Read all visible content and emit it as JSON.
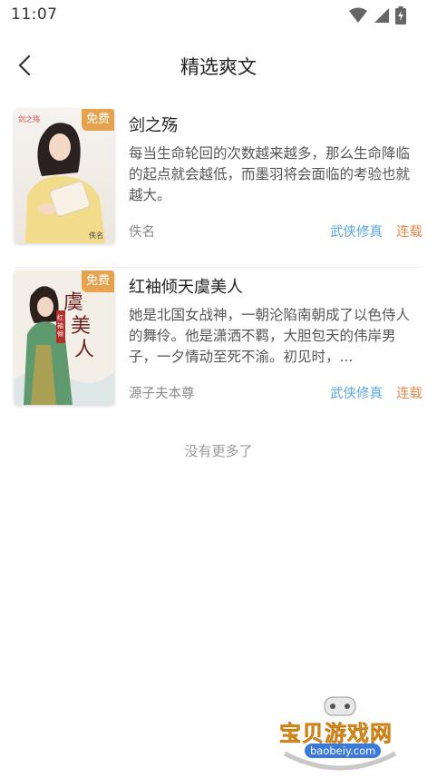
{
  "status_bar": {
    "time": "11:07",
    "icons": [
      "wifi-icon",
      "signal-icon",
      "battery-charging-icon"
    ]
  },
  "nav": {
    "back_icon": "chevron-left-icon",
    "title": "精选爽文"
  },
  "books": [
    {
      "free_tag": "免费",
      "title": "剑之殇",
      "description": "每当生命轮回的次数越来越多，那么生命降临的起点就会越低，而墨羽将会面临的考验也就越大。",
      "author": "佚名",
      "genre": "武侠修真",
      "status": "连载"
    },
    {
      "free_tag": "免费",
      "title": "红袖倾天虞美人",
      "description": "她是北国女战神，一朝沦陷南朝成了以色侍人的舞伶。他是潇洒不羁，大胆包天的伟岸男子，一夕情动至死不渝。初见时，...",
      "author": "源子夫本尊",
      "genre": "武侠修真",
      "status": "连载"
    }
  ],
  "footer": {
    "no_more": "没有更多了"
  },
  "watermark": {
    "text": "宝贝游戏网",
    "url": "baobeiy.com"
  },
  "colors": {
    "free_tag": "#e5a34f",
    "genre": "#5aa8d8",
    "status": "#e8884a",
    "author": "#8a8a8a"
  }
}
